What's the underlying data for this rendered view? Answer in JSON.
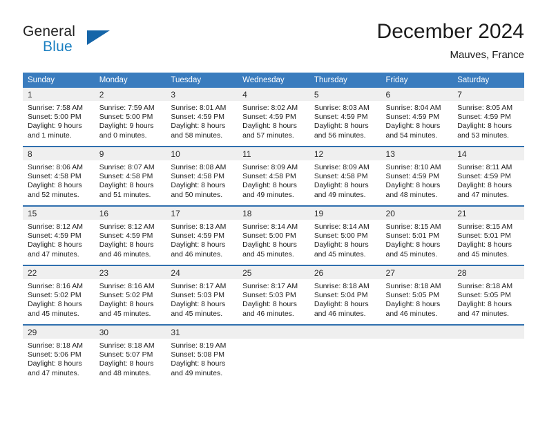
{
  "brand": {
    "word_one": "General",
    "word_two": "Blue",
    "flag_icon": "blue-triangle-flag-icon"
  },
  "header": {
    "title": "December 2024",
    "subtitle": "Mauves, France"
  },
  "colors": {
    "header_blue": "#3a7cbe",
    "row_divider_blue": "#2f6fae",
    "daynum_band": "#efefef",
    "brand_blue": "#1a7fc1",
    "flag_blue": "#1565a8",
    "text": "#1e1e1e"
  },
  "calendar": {
    "weekday_headers": [
      "Sunday",
      "Monday",
      "Tuesday",
      "Wednesday",
      "Thursday",
      "Friday",
      "Saturday"
    ],
    "weeks": [
      [
        {
          "day": "1",
          "sunrise": "Sunrise: 7:58 AM",
          "sunset": "Sunset: 5:00 PM",
          "daylight_line1": "Daylight: 9 hours",
          "daylight_line2": "and 1 minute."
        },
        {
          "day": "2",
          "sunrise": "Sunrise: 7:59 AM",
          "sunset": "Sunset: 5:00 PM",
          "daylight_line1": "Daylight: 9 hours",
          "daylight_line2": "and 0 minutes."
        },
        {
          "day": "3",
          "sunrise": "Sunrise: 8:01 AM",
          "sunset": "Sunset: 4:59 PM",
          "daylight_line1": "Daylight: 8 hours",
          "daylight_line2": "and 58 minutes."
        },
        {
          "day": "4",
          "sunrise": "Sunrise: 8:02 AM",
          "sunset": "Sunset: 4:59 PM",
          "daylight_line1": "Daylight: 8 hours",
          "daylight_line2": "and 57 minutes."
        },
        {
          "day": "5",
          "sunrise": "Sunrise: 8:03 AM",
          "sunset": "Sunset: 4:59 PM",
          "daylight_line1": "Daylight: 8 hours",
          "daylight_line2": "and 56 minutes."
        },
        {
          "day": "6",
          "sunrise": "Sunrise: 8:04 AM",
          "sunset": "Sunset: 4:59 PM",
          "daylight_line1": "Daylight: 8 hours",
          "daylight_line2": "and 54 minutes."
        },
        {
          "day": "7",
          "sunrise": "Sunrise: 8:05 AM",
          "sunset": "Sunset: 4:59 PM",
          "daylight_line1": "Daylight: 8 hours",
          "daylight_line2": "and 53 minutes."
        }
      ],
      [
        {
          "day": "8",
          "sunrise": "Sunrise: 8:06 AM",
          "sunset": "Sunset: 4:58 PM",
          "daylight_line1": "Daylight: 8 hours",
          "daylight_line2": "and 52 minutes."
        },
        {
          "day": "9",
          "sunrise": "Sunrise: 8:07 AM",
          "sunset": "Sunset: 4:58 PM",
          "daylight_line1": "Daylight: 8 hours",
          "daylight_line2": "and 51 minutes."
        },
        {
          "day": "10",
          "sunrise": "Sunrise: 8:08 AM",
          "sunset": "Sunset: 4:58 PM",
          "daylight_line1": "Daylight: 8 hours",
          "daylight_line2": "and 50 minutes."
        },
        {
          "day": "11",
          "sunrise": "Sunrise: 8:09 AM",
          "sunset": "Sunset: 4:58 PM",
          "daylight_line1": "Daylight: 8 hours",
          "daylight_line2": "and 49 minutes."
        },
        {
          "day": "12",
          "sunrise": "Sunrise: 8:09 AM",
          "sunset": "Sunset: 4:58 PM",
          "daylight_line1": "Daylight: 8 hours",
          "daylight_line2": "and 49 minutes."
        },
        {
          "day": "13",
          "sunrise": "Sunrise: 8:10 AM",
          "sunset": "Sunset: 4:59 PM",
          "daylight_line1": "Daylight: 8 hours",
          "daylight_line2": "and 48 minutes."
        },
        {
          "day": "14",
          "sunrise": "Sunrise: 8:11 AM",
          "sunset": "Sunset: 4:59 PM",
          "daylight_line1": "Daylight: 8 hours",
          "daylight_line2": "and 47 minutes."
        }
      ],
      [
        {
          "day": "15",
          "sunrise": "Sunrise: 8:12 AM",
          "sunset": "Sunset: 4:59 PM",
          "daylight_line1": "Daylight: 8 hours",
          "daylight_line2": "and 47 minutes."
        },
        {
          "day": "16",
          "sunrise": "Sunrise: 8:12 AM",
          "sunset": "Sunset: 4:59 PM",
          "daylight_line1": "Daylight: 8 hours",
          "daylight_line2": "and 46 minutes."
        },
        {
          "day": "17",
          "sunrise": "Sunrise: 8:13 AM",
          "sunset": "Sunset: 4:59 PM",
          "daylight_line1": "Daylight: 8 hours",
          "daylight_line2": "and 46 minutes."
        },
        {
          "day": "18",
          "sunrise": "Sunrise: 8:14 AM",
          "sunset": "Sunset: 5:00 PM",
          "daylight_line1": "Daylight: 8 hours",
          "daylight_line2": "and 45 minutes."
        },
        {
          "day": "19",
          "sunrise": "Sunrise: 8:14 AM",
          "sunset": "Sunset: 5:00 PM",
          "daylight_line1": "Daylight: 8 hours",
          "daylight_line2": "and 45 minutes."
        },
        {
          "day": "20",
          "sunrise": "Sunrise: 8:15 AM",
          "sunset": "Sunset: 5:01 PM",
          "daylight_line1": "Daylight: 8 hours",
          "daylight_line2": "and 45 minutes."
        },
        {
          "day": "21",
          "sunrise": "Sunrise: 8:15 AM",
          "sunset": "Sunset: 5:01 PM",
          "daylight_line1": "Daylight: 8 hours",
          "daylight_line2": "and 45 minutes."
        }
      ],
      [
        {
          "day": "22",
          "sunrise": "Sunrise: 8:16 AM",
          "sunset": "Sunset: 5:02 PM",
          "daylight_line1": "Daylight: 8 hours",
          "daylight_line2": "and 45 minutes."
        },
        {
          "day": "23",
          "sunrise": "Sunrise: 8:16 AM",
          "sunset": "Sunset: 5:02 PM",
          "daylight_line1": "Daylight: 8 hours",
          "daylight_line2": "and 45 minutes."
        },
        {
          "day": "24",
          "sunrise": "Sunrise: 8:17 AM",
          "sunset": "Sunset: 5:03 PM",
          "daylight_line1": "Daylight: 8 hours",
          "daylight_line2": "and 45 minutes."
        },
        {
          "day": "25",
          "sunrise": "Sunrise: 8:17 AM",
          "sunset": "Sunset: 5:03 PM",
          "daylight_line1": "Daylight: 8 hours",
          "daylight_line2": "and 46 minutes."
        },
        {
          "day": "26",
          "sunrise": "Sunrise: 8:18 AM",
          "sunset": "Sunset: 5:04 PM",
          "daylight_line1": "Daylight: 8 hours",
          "daylight_line2": "and 46 minutes."
        },
        {
          "day": "27",
          "sunrise": "Sunrise: 8:18 AM",
          "sunset": "Sunset: 5:05 PM",
          "daylight_line1": "Daylight: 8 hours",
          "daylight_line2": "and 46 minutes."
        },
        {
          "day": "28",
          "sunrise": "Sunrise: 8:18 AM",
          "sunset": "Sunset: 5:05 PM",
          "daylight_line1": "Daylight: 8 hours",
          "daylight_line2": "and 47 minutes."
        }
      ],
      [
        {
          "day": "29",
          "sunrise": "Sunrise: 8:18 AM",
          "sunset": "Sunset: 5:06 PM",
          "daylight_line1": "Daylight: 8 hours",
          "daylight_line2": "and 47 minutes."
        },
        {
          "day": "30",
          "sunrise": "Sunrise: 8:18 AM",
          "sunset": "Sunset: 5:07 PM",
          "daylight_line1": "Daylight: 8 hours",
          "daylight_line2": "and 48 minutes."
        },
        {
          "day": "31",
          "sunrise": "Sunrise: 8:19 AM",
          "sunset": "Sunset: 5:08 PM",
          "daylight_line1": "Daylight: 8 hours",
          "daylight_line2": "and 49 minutes."
        },
        {
          "day": "",
          "sunrise": "",
          "sunset": "",
          "daylight_line1": "",
          "daylight_line2": ""
        },
        {
          "day": "",
          "sunrise": "",
          "sunset": "",
          "daylight_line1": "",
          "daylight_line2": ""
        },
        {
          "day": "",
          "sunrise": "",
          "sunset": "",
          "daylight_line1": "",
          "daylight_line2": ""
        },
        {
          "day": "",
          "sunrise": "",
          "sunset": "",
          "daylight_line1": "",
          "daylight_line2": ""
        }
      ]
    ]
  }
}
